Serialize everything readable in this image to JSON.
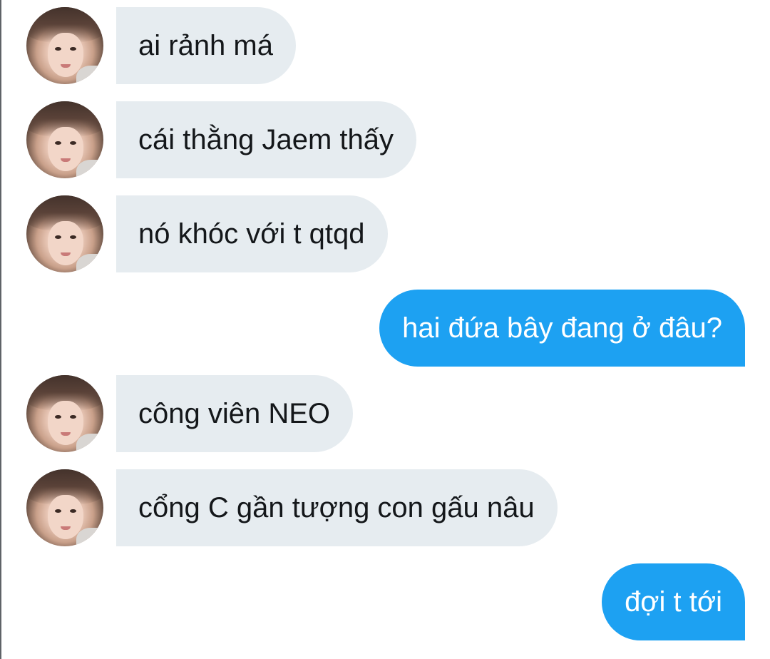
{
  "chat": {
    "messages": [
      {
        "sender": "other",
        "text": "ai rảnh má"
      },
      {
        "sender": "other",
        "text": "cái thằng Jaem thấy"
      },
      {
        "sender": "other",
        "text": "nó khóc với t qtqd"
      },
      {
        "sender": "me",
        "text": "hai đứa bây đang ở đâu?"
      },
      {
        "sender": "other",
        "text": "công viên NEO"
      },
      {
        "sender": "other",
        "text": "cổng C gần tượng con gấu nâu"
      },
      {
        "sender": "me",
        "text": "đợi t tới"
      }
    ]
  },
  "colors": {
    "incoming_bubble": "#e6ecf0",
    "outgoing_bubble": "#1da1f2",
    "incoming_text": "#14171a",
    "outgoing_text": "#ffffff"
  }
}
